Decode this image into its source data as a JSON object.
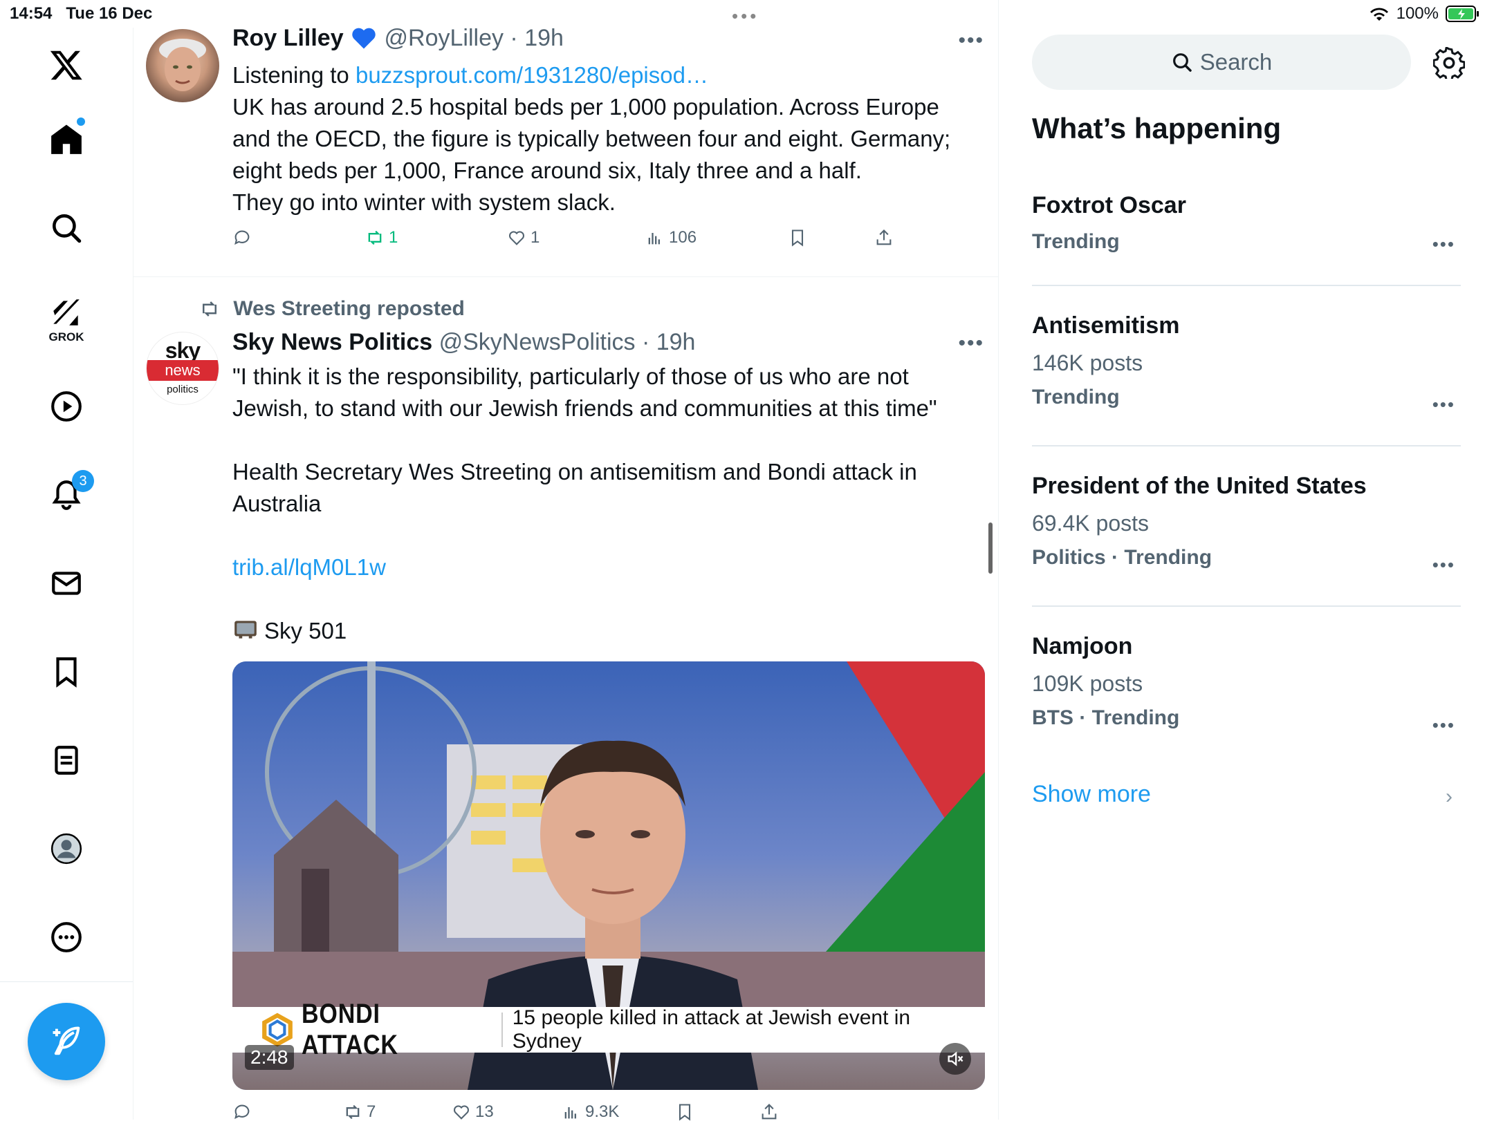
{
  "status": {
    "time": "14:54",
    "date": "Tue 16 Dec",
    "battery": "100%"
  },
  "nav": {
    "grok_label": "GROK",
    "notifications_count": "3"
  },
  "tweets": [
    {
      "name": "Roy Lilley",
      "handle": "@RoyLilley",
      "time": "19h",
      "link_prefix": "Listening to ",
      "link": "buzzsprout.com/1931280/episod…",
      "lines": [
        "UK has around 2.5 hospital beds per 1,000 population. Across Europe",
        "and the OECD, the figure is typically between four and eight. Germany;",
        "eight beds per 1,000, France around six, Italy three and a half.",
        "They go into winter with system slack."
      ],
      "retweets": "1",
      "likes": "1",
      "views": "106"
    },
    {
      "repost_by": "Wes Streeting reposted",
      "name": "Sky News Politics",
      "handle": "@SkyNewsPolitics",
      "time": "19h",
      "avatar_text": {
        "sky": "sky",
        "news": "news",
        "politics": "politics"
      },
      "quote_line1": "\"I think it is the responsibility, particularly of those of us who are not",
      "quote_line2": "Jewish, to stand with our Jewish friends and communities at this time\"",
      "para_line1": "Health Secretary Wes Streeting on antisemitism and Bondi attack in",
      "para_line2": "Australia",
      "link": "trib.al/lqM0L1w",
      "channel": "Sky 501",
      "video": {
        "headline": "BONDI ATTACK",
        "ticker": "15 people killed in attack at Jewish event in Sydney",
        "duration": "2:48"
      },
      "retweets": "7",
      "likes": "13",
      "views": "9.3K"
    }
  ],
  "search": {
    "placeholder": "Search"
  },
  "whats_happening": {
    "title": "What’s happening",
    "trends": [
      {
        "name": "Foxtrot Oscar",
        "posts": "",
        "meta": "Trending"
      },
      {
        "name": "Antisemitism",
        "posts": "146K posts",
        "meta": "Trending"
      },
      {
        "name": "President of the United States",
        "posts": "69.4K posts",
        "meta": "Politics · Trending"
      },
      {
        "name": "Namjoon",
        "posts": "109K posts",
        "meta": "BTS · Trending"
      }
    ],
    "show_more": "Show more"
  },
  "colors": {
    "accent": "#1d9bf0",
    "retweet_green": "#00ba7c",
    "muted": "#536471"
  }
}
